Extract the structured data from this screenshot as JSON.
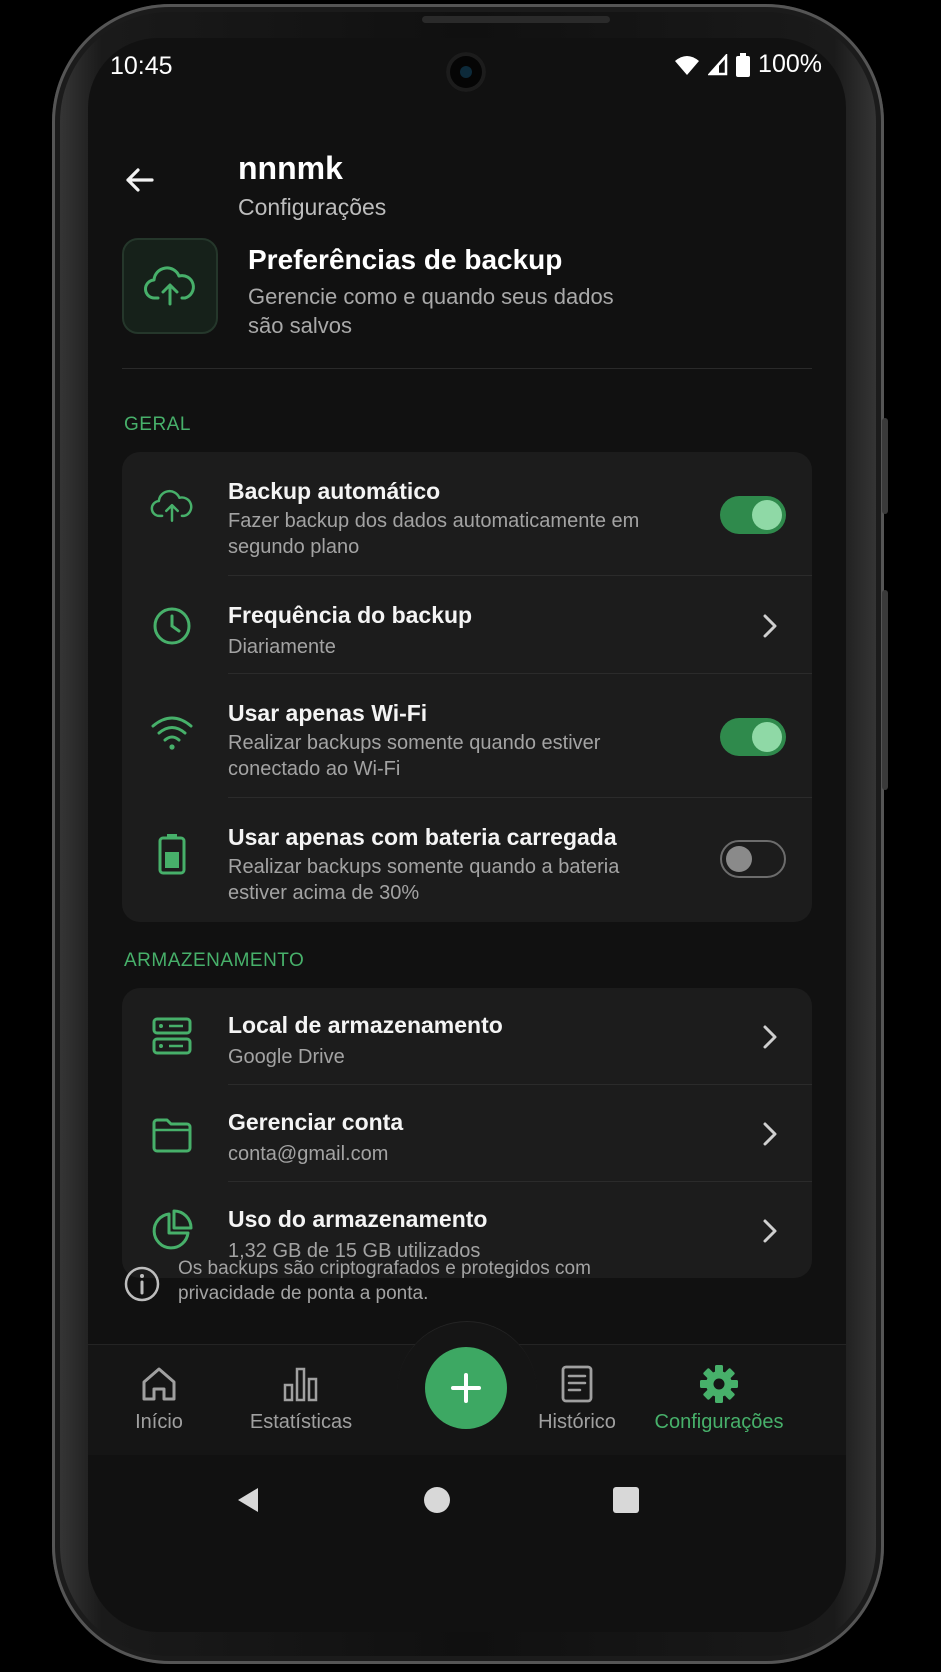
{
  "status_bar": {
    "time": "10:45",
    "battery": "100%"
  },
  "header": {
    "title": "nnnmk",
    "subtitle": "Configurações"
  },
  "hero": {
    "title": "Preferências de backup",
    "subtitle": "Gerencie como e quando seus dados são salvos"
  },
  "sections": {
    "general": {
      "label": "GERAL",
      "items": [
        {
          "title": "Backup automático",
          "subtitle": "Fazer backup dos dados automaticamente em segundo plano",
          "toggle": true
        },
        {
          "title": "Frequência do backup",
          "subtitle": "Diariamente"
        },
        {
          "title": "Usar apenas Wi-Fi",
          "subtitle": "Realizar backups somente quando estiver conectado ao Wi-Fi",
          "toggle": true
        },
        {
          "title": "Usar apenas com bateria carregada",
          "subtitle": "Realizar backups somente quando a bateria estiver acima de 30%",
          "toggle": false
        }
      ]
    },
    "storage": {
      "label": "ARMAZENAMENTO",
      "items": [
        {
          "title": "Local de armazenamento",
          "subtitle": "Google Drive"
        },
        {
          "title": "Gerenciar conta",
          "subtitle": "conta@gmail.com"
        },
        {
          "title": "Uso do armazenamento",
          "subtitle": "1,32 GB de 15 GB utilizados"
        }
      ]
    }
  },
  "info_text": "Os backups são criptografados e protegidos com privacidade de ponta a ponta.",
  "bottom_nav": {
    "items": [
      {
        "label": "Início",
        "icon": "home-icon"
      },
      {
        "label": "Estatísticas",
        "icon": "bar-chart-icon"
      },
      {
        "label": "Histórico",
        "icon": "document-icon"
      },
      {
        "label": "Configurações",
        "icon": "gear-icon",
        "active": true
      }
    ],
    "fab_icon": "plus-icon"
  },
  "colors": {
    "accent": "#47b06a",
    "background": "#111111",
    "card": "#1c1c1c"
  }
}
